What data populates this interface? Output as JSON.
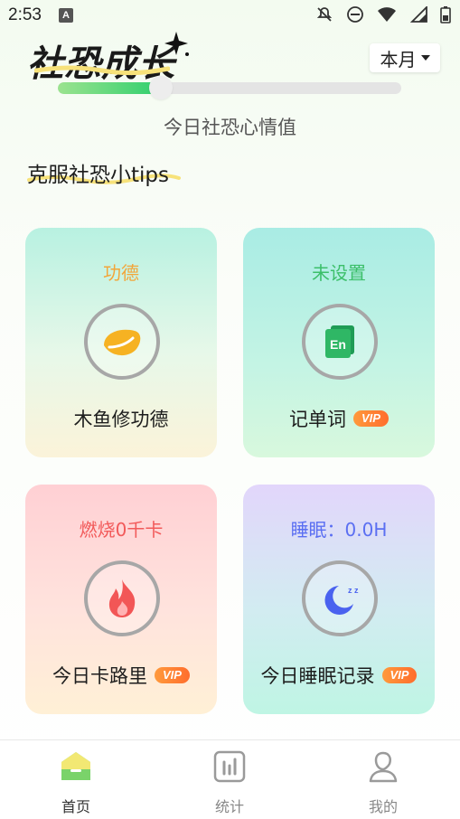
{
  "status_bar": {
    "time": "2:53",
    "notification_letter": "A"
  },
  "header": {
    "title": "社恐成长",
    "period_select": "本月"
  },
  "mood": {
    "label": "今日社恐心情值",
    "value_fraction": 0.3
  },
  "tips": {
    "title": "克服社恐小tips"
  },
  "cards": [
    {
      "status": "功德",
      "label": "木鱼修功德",
      "vip": false,
      "status_color": "#f2a63a",
      "icon": "wooden-fish-icon"
    },
    {
      "status": "未设置",
      "label": "记单词",
      "vip": true,
      "vip_label": "VIP",
      "status_color": "#3cbf6a",
      "icon": "vocabulary-icon",
      "icon_text": "En"
    },
    {
      "status": "燃烧0千卡",
      "label": "今日卡路里",
      "vip": true,
      "vip_label": "VIP",
      "status_color": "#f25a5a",
      "icon": "flame-icon"
    },
    {
      "status": "睡眠：0.0H",
      "label": "今日睡眠记录",
      "vip": true,
      "vip_label": "VIP",
      "status_color": "#5b6ff2",
      "icon": "moon-icon",
      "icon_text": "z z"
    }
  ],
  "nav": [
    {
      "label": "首页",
      "active": true,
      "icon": "home-icon"
    },
    {
      "label": "统计",
      "active": false,
      "icon": "stats-icon"
    },
    {
      "label": "我的",
      "active": false,
      "icon": "profile-icon"
    }
  ]
}
